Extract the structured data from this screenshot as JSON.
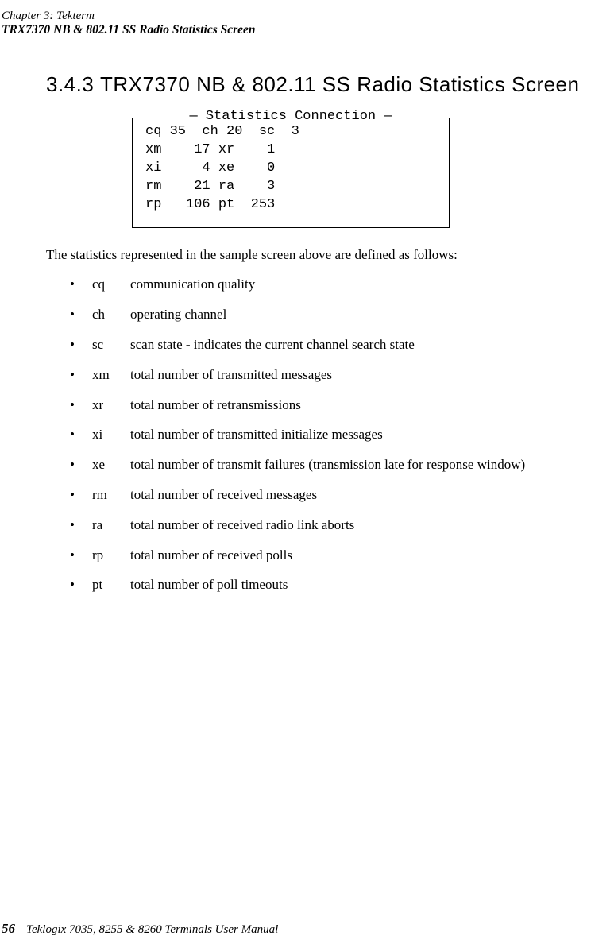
{
  "header": {
    "left": "Chapter 3: Tekterm",
    "right": "TRX7370 NB & 802.11 SS Radio Statistics Screen"
  },
  "section": {
    "number": "3.4.3",
    "title": "TRX7370 NB & 802.11 SS Radio Statistics Screen"
  },
  "stats": {
    "caption": "Statistics Connection",
    "rows": [
      "cq 35  ch 20  sc  3",
      "xm    17 xr    1",
      "xi     4 xe    0",
      "rm    21 ra    3",
      "rp   106 pt  253"
    ]
  },
  "paragraph": "The statistics represented in the sample screen above are defined as follows:",
  "defs": [
    {
      "abbr": "cq",
      "desc": "communication quality"
    },
    {
      "abbr": "ch",
      "desc": "operating channel"
    },
    {
      "abbr": "sc",
      "desc": "scan state - indicates the current channel search state"
    },
    {
      "abbr": "xm",
      "desc": "total number of transmitted messages"
    },
    {
      "abbr": "xr",
      "desc": "total number of retransmissions"
    },
    {
      "abbr": "xi",
      "desc": "total number of transmitted initialize messages"
    },
    {
      "abbr": "xe",
      "desc": "total number of transmit failures (transmission late for response window)"
    },
    {
      "abbr": "rm",
      "desc": "total number of received messages"
    },
    {
      "abbr": "ra",
      "desc": "total number of received radio link aborts"
    },
    {
      "abbr": "rp",
      "desc": "total number of received polls"
    },
    {
      "abbr": "pt",
      "desc": "total number of poll timeouts"
    }
  ],
  "footer": {
    "page": "56",
    "text": "Teklogix 7035, 8255 & 8260 Terminals User Manual"
  }
}
